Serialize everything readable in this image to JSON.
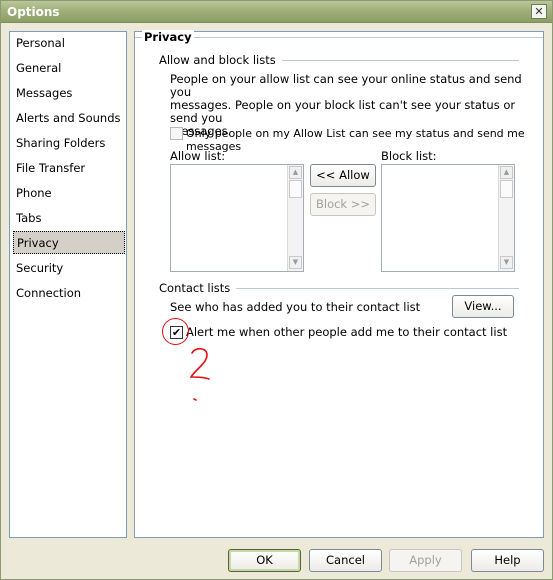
{
  "window": {
    "title": "Options",
    "close_glyph": "✕"
  },
  "nav": {
    "items": [
      {
        "label": "Personal"
      },
      {
        "label": "General"
      },
      {
        "label": "Messages"
      },
      {
        "label": "Alerts and Sounds"
      },
      {
        "label": "Sharing Folders"
      },
      {
        "label": "File Transfer"
      },
      {
        "label": "Phone"
      },
      {
        "label": "Tabs"
      },
      {
        "label": "Privacy",
        "selected": true
      },
      {
        "label": "Security"
      },
      {
        "label": "Connection"
      }
    ]
  },
  "privacy": {
    "title": "Privacy",
    "allow_block": {
      "heading": "Allow and block lists",
      "description": [
        "People on your allow list can see your online status and send you",
        "messages.  People on your block list can't see your status or send you",
        "messages."
      ],
      "only_allow_checkbox": {
        "label": "Only people on my Allow List can see my status and send me messages",
        "checked": false
      },
      "allow_list_label": "Allow list:",
      "block_list_label": "Block list:",
      "allow_button": "<< Allow",
      "block_button": "Block >>"
    },
    "contact_lists": {
      "heading": "Contact lists",
      "see_who_text": "See who has added you to their contact list",
      "view_button": "View...",
      "alert_checkbox": {
        "label": "Alert me when other people add me to their contact list",
        "checked": true
      }
    }
  },
  "footer": {
    "ok": "OK",
    "cancel": "Cancel",
    "apply": "Apply",
    "help": "Help"
  },
  "colors": {
    "annotation": "#e01010",
    "title_bar": "#9fb07a"
  }
}
